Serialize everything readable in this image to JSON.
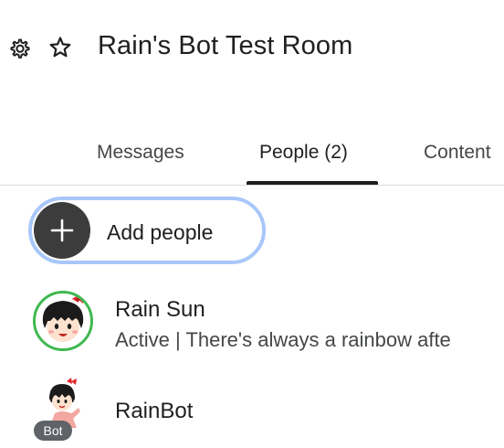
{
  "header": {
    "room_title": "Rain's Bot Test Room",
    "settings_icon": "gear-icon",
    "star_icon": "star-outline-icon"
  },
  "tabs": [
    {
      "label": "Messages",
      "selected": false
    },
    {
      "label": "People (2)",
      "selected": true
    },
    {
      "label": "Content",
      "selected": false
    }
  ],
  "add_people": {
    "label": "Add people",
    "icon": "plus-icon",
    "border_color": "#a8c7fa"
  },
  "people": [
    {
      "name": "Rain Sun",
      "status": "Active | There's always a rainbow afte",
      "presence_color": "#3fb950",
      "avatar": "cartoon-girl-avatar"
    },
    {
      "name": "RainBot",
      "badge": "Bot",
      "avatar": "cartoon-girl-bot-avatar"
    }
  ],
  "colors": {
    "text_primary": "#1f1f1f",
    "text_secondary": "#444746",
    "divider": "#dadce0",
    "badge_bg": "#5f6368"
  }
}
